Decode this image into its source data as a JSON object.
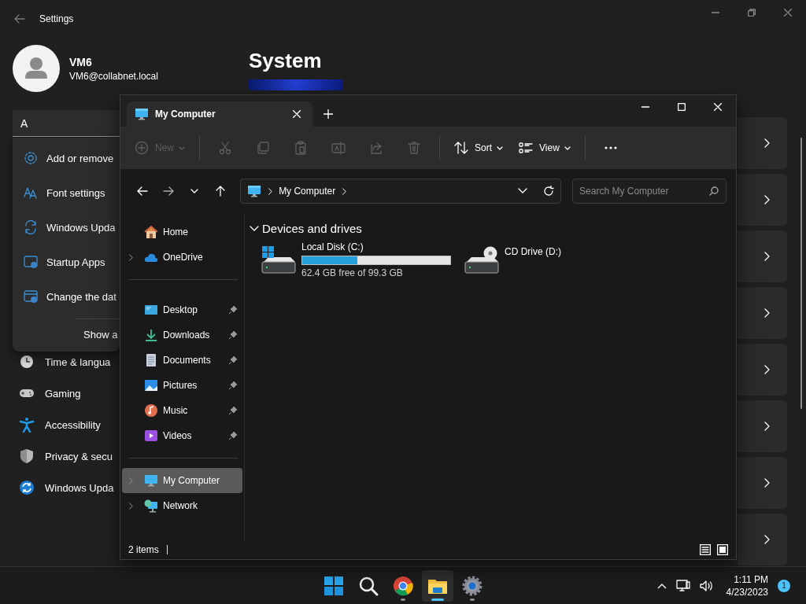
{
  "settings": {
    "title": "Settings",
    "user": {
      "name": "VM6",
      "email": "VM6@collabnet.local"
    },
    "search": {
      "value": "A"
    },
    "suggestions": [
      "Add or remove",
      "Font settings",
      "Windows Upda",
      "Startup Apps",
      "Change the dat"
    ],
    "suggestions_footer": "Show a",
    "nav": [
      "Time & langua",
      "Gaming",
      "Accessibility",
      "Privacy & secu",
      "Windows Upda"
    ],
    "heading": "System"
  },
  "explorer": {
    "tab": "My Computer",
    "toolbar": [
      {
        "label": "New",
        "disabled": true
      },
      {
        "disabled": true
      },
      {
        "disabled": true
      },
      {
        "disabled": true
      },
      {
        "disabled": true
      },
      {
        "disabled": true
      },
      {
        "disabled": true
      },
      {
        "label": "Sort",
        "disabled": false
      },
      {
        "label": "View",
        "disabled": false
      },
      {
        "disabled": false
      }
    ],
    "breadcrumb": [
      "My Computer"
    ],
    "search": {
      "placeholder": "Search My Computer"
    },
    "nav_groups": [
      [
        {
          "label": "Home",
          "expandable": false,
          "pinned": false,
          "selected": false
        },
        {
          "label": "OneDrive",
          "expandable": true,
          "pinned": false,
          "selected": false
        }
      ],
      [
        {
          "label": "Desktop",
          "expandable": false,
          "pinned": true,
          "selected": false
        },
        {
          "label": "Downloads",
          "expandable": false,
          "pinned": true,
          "selected": false
        },
        {
          "label": "Documents",
          "expandable": false,
          "pinned": true,
          "selected": false
        },
        {
          "label": "Pictures",
          "expandable": false,
          "pinned": true,
          "selected": false
        },
        {
          "label": "Music",
          "expandable": false,
          "pinned": true,
          "selected": false
        },
        {
          "label": "Videos",
          "expandable": false,
          "pinned": true,
          "selected": false
        }
      ],
      [
        {
          "label": "My Computer",
          "expandable": true,
          "pinned": false,
          "selected": true
        },
        {
          "label": "Network",
          "expandable": true,
          "pinned": false,
          "selected": false
        }
      ]
    ],
    "section": {
      "title": "Devices and drives",
      "expanded": true
    },
    "drives": [
      {
        "kind": "disk",
        "name": "Local Disk (C:)",
        "level": 0.37,
        "reading": "62.4 GB free of 99.3 GB"
      },
      {
        "kind": "optical",
        "name": "CD Drive (D:)"
      }
    ],
    "status": "2 items"
  },
  "taskbar": {
    "apps": [
      {
        "running": false,
        "active": false
      },
      {
        "running": false,
        "active": false
      },
      {
        "running": true,
        "active": false
      },
      {
        "running": true,
        "active": true
      },
      {
        "running": true,
        "active": false
      }
    ],
    "time": "1:11 PM",
    "date": "4/23/2023",
    "notifications": "1"
  }
}
